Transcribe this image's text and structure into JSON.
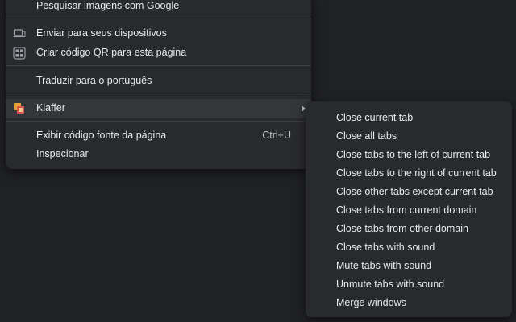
{
  "main_menu": {
    "search_images": "Pesquisar imagens com Google",
    "send_devices": "Enviar para seus dispositivos",
    "create_qr": "Criar código QR para esta página",
    "translate": "Traduzir para o português",
    "klaffer": "Klaffer",
    "view_source": "Exibir código fonte da página",
    "view_source_shortcut": "Ctrl+U",
    "inspect": "Inspecionar"
  },
  "sub_menu": {
    "items": [
      "Close current tab",
      "Close all tabs",
      "Close tabs to the left of current tab",
      "Close tabs to the right of current tab",
      "Close other tabs except current tab",
      "Close tabs from current domain",
      "Close tabs from other domain",
      "Close tabs with sound",
      "Mute tabs with sound",
      "Unmute tabs with sound",
      "Merge windows"
    ]
  },
  "colors": {
    "page_background": "#202124",
    "menu_background": "#292a2d",
    "text": "#e8eaed",
    "separator": "#3c4043",
    "highlight": "#35363a"
  }
}
